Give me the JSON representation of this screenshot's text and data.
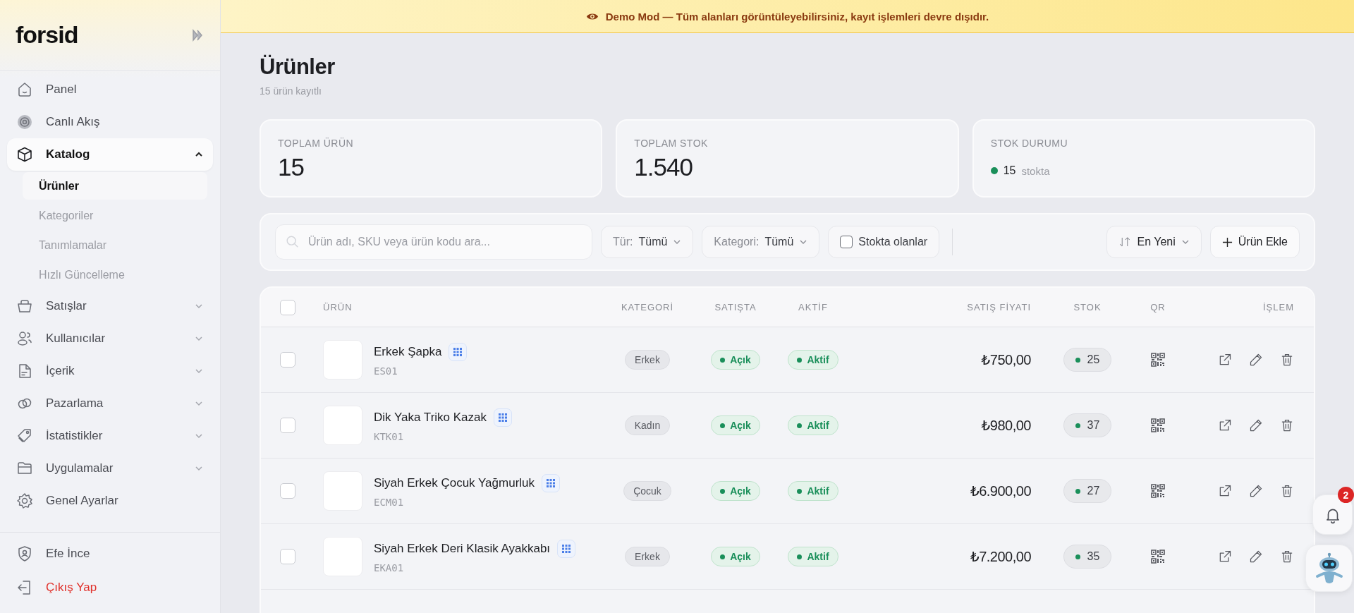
{
  "banner": {
    "text": "Demo Mod — Tüm alanları görüntüleyebilirsiniz, kayıt işlemleri devre dışıdır."
  },
  "sidebar": {
    "logo": "forsid",
    "items": [
      {
        "label": "Panel",
        "selected": false
      },
      {
        "label": "Canlı Akış",
        "selected": false
      },
      {
        "label": "Katalog",
        "selected": true,
        "expanded": true,
        "children": [
          {
            "label": "Ürünler",
            "selected": true
          },
          {
            "label": "Kategoriler",
            "selected": false
          },
          {
            "label": "Tanımlamalar",
            "selected": false
          },
          {
            "label": "Hızlı Güncelleme",
            "selected": false
          }
        ]
      },
      {
        "label": "Satışlar",
        "selected": false,
        "expanded": false
      },
      {
        "label": "Kullanıcılar",
        "selected": false,
        "expanded": false
      },
      {
        "label": "İçerik",
        "selected": false,
        "expanded": false
      },
      {
        "label": "Pazarlama",
        "selected": false,
        "expanded": false
      },
      {
        "label": "İstatistikler",
        "selected": false,
        "expanded": false
      },
      {
        "label": "Uygulamalar",
        "selected": false,
        "expanded": false
      },
      {
        "label": "Genel Ayarlar",
        "selected": false
      }
    ],
    "user": "Efe İnce",
    "logout": "Çıkış Yap"
  },
  "page": {
    "title": "Ürünler",
    "subtitle": "15 ürün kayıtlı"
  },
  "stats": [
    {
      "kind": "number",
      "label": "TOPLAM ÜRÜN",
      "value": "15"
    },
    {
      "kind": "number",
      "label": "TOPLAM STOK",
      "value": "1.540"
    },
    {
      "kind": "status",
      "label": "STOK DURUMU",
      "value": "15",
      "suffix": "stokta"
    }
  ],
  "toolbar": {
    "search": {
      "placeholder": "Ürün adı, SKU veya ürün kodu ara..."
    },
    "filters": [
      {
        "label": "Tür:",
        "value": "Tümü"
      },
      {
        "label": "Kategori:",
        "value": "Tümü"
      }
    ],
    "in_stock": {
      "label": "Stokta olanlar",
      "checked": false
    },
    "sort": {
      "value": "En Yeni"
    },
    "add_button": "Ürün Ekle"
  },
  "table": {
    "select_all": {
      "checked": false
    },
    "columns": [
      "ÜRÜN",
      "KATEGORİ",
      "SATIŞTA",
      "AKTİF",
      "SATIŞ FİYATI",
      "STOK",
      "QR",
      "İŞLEM"
    ],
    "rows": [
      {
        "selected": false,
        "name": "Erkek Şapka",
        "sku": "ES01",
        "category_text": "Erkek",
        "on_sale": "Açık",
        "active": "Aktif",
        "price": "₺750,00",
        "stock": "25"
      },
      {
        "selected": false,
        "name": "Dik Yaka Triko Kazak",
        "sku": "KTK01",
        "category_text": "Kadın",
        "on_sale": "Açık",
        "active": "Aktif",
        "price": "₺980,00",
        "stock": "37"
      },
      {
        "selected": false,
        "name": "Siyah Erkek Çocuk Yağmurluk",
        "sku": "ECM01",
        "category_text": "Çocuk",
        "on_sale": "Açık",
        "active": "Aktif",
        "price": "₺6.900,00",
        "stock": "27"
      },
      {
        "selected": false,
        "name": "Siyah Erkek Deri Klasik Ayakkabı",
        "sku": "EKA01",
        "category_text": "Erkek",
        "on_sale": "Açık",
        "active": "Aktif",
        "price": "₺7.200,00",
        "stock": "35"
      }
    ]
  },
  "notifications": {
    "count": "2"
  }
}
